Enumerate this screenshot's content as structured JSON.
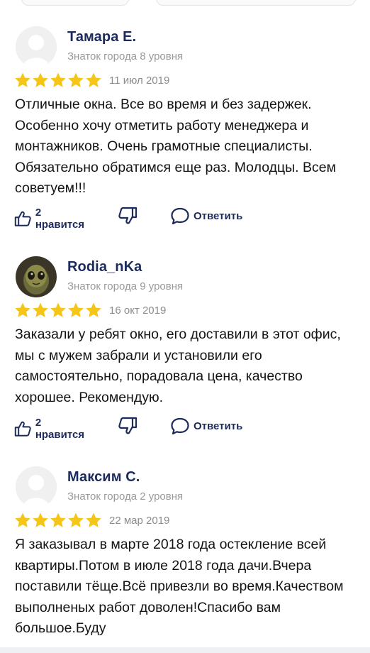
{
  "reviews": [
    {
      "name": "Тамара Е.",
      "level": "Знаток города 8 уровня",
      "rating": 5,
      "date": "11 июл 2019",
      "text": "Отличные окна. Все во время и без задержек. Особенно хочу отметить работу менеджера и монтажников. Очень грамотные специалисты. Обязательно обратимся еще раз. Молодцы. Всем советуем!!!",
      "likes": "2 нравится",
      "reply": "Ответить",
      "avatar": "placeholder"
    },
    {
      "name": "Rodia_nKa",
      "level": "Знаток города 9 уровня",
      "rating": 5,
      "date": "16 окт 2019",
      "text": "Заказали у ребят окно, его доставили в этот офис, мы с мужем забрали и установили его самостоятельно, порадовала цена, качество хорошее. Рекомендую.",
      "likes": "2 нравится",
      "reply": "Ответить",
      "avatar": "alien-photo"
    },
    {
      "name": "Максим С.",
      "level": "Знаток города 2 уровня",
      "rating": 5,
      "date": "22 мар 2019",
      "text": "Я заказывал в марте 2018 года остекление всей квартиры.Потом в июле 2018 года дачи.Вчера поставили тёще.Всё привезли во время.Качеством выполненых работ доволен!Спасибо вам большое.Буду",
      "avatar": "placeholder"
    }
  ],
  "colors": {
    "star": "#f5c518",
    "name": "#1d2b5c",
    "meta": "#9a9a9a",
    "action": "#1d2b5c"
  },
  "icons": {
    "like": "thumbs-up-icon",
    "dislike": "thumbs-down-icon",
    "reply": "comment-bubble-icon",
    "star": "star-icon"
  }
}
